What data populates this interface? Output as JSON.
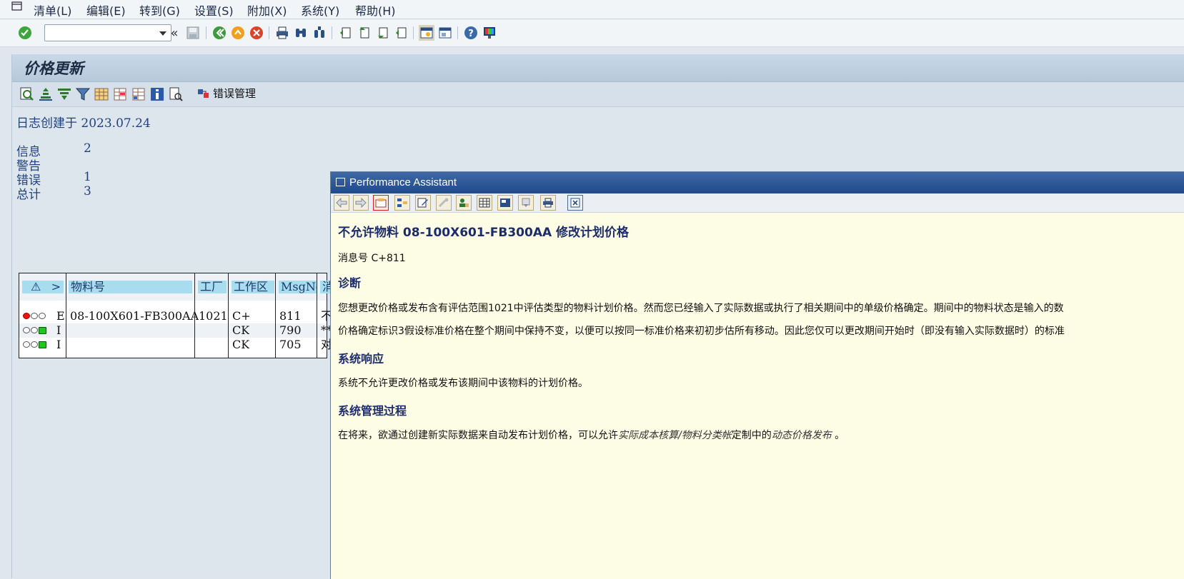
{
  "menu": {
    "items": [
      "清单(L)",
      "编辑(E)",
      "转到(G)",
      "设置(S)",
      "附加(X)",
      "系统(Y)",
      "帮助(H)"
    ]
  },
  "toolbar": {
    "command_value": "",
    "nav_back_label": "«"
  },
  "screen": {
    "title": "价格更新",
    "error_mgmt_label": "错误管理"
  },
  "log": {
    "created_text": "日志创建于 2023.07.24",
    "stats": [
      {
        "label": "信息",
        "value": "2"
      },
      {
        "label": "警告",
        "value": ""
      },
      {
        "label": "错误",
        "value": "1"
      },
      {
        "label": "总计",
        "value": "3"
      }
    ]
  },
  "grid": {
    "headers": [
      "⚠",
      "物料号",
      "工厂",
      "工作区",
      "MsgNo",
      "消"
    ],
    "rows": [
      {
        "light": "red",
        "type": "E",
        "material": "08-100X601-FB300AA",
        "plant": "1021",
        "area": "C+",
        "msgno": "811",
        "text": "不"
      },
      {
        "light": "green",
        "type": "I",
        "material": "",
        "plant": "",
        "area": "CK",
        "msgno": "790",
        "text": "**"
      },
      {
        "light": "green",
        "type": "I",
        "material": "",
        "plant": "",
        "area": "CK",
        "msgno": "705",
        "text": "对"
      }
    ]
  },
  "assistant": {
    "window_title": "Performance Assistant",
    "heading": "不允许物料 08-100X601-FB300AA  修改计划价格",
    "msg_no": "消息号 C+811",
    "h_diagnosis": "诊断",
    "diag_p1": "您想更改价格或发布含有评估范围1021中评估类型的物料计划价格。然而您已经输入了实际数据或执行了相关期间中的单级价格确定。期间中的物料状态是输入的数",
    "diag_p2": "价格确定标识3假设标准价格在整个期间中保持不变，以便可以按同一标准价格来初初步估所有移动。因此您仅可以更改期间开始时（即没有输入实际数据时）的标准",
    "h_response": "系统响应",
    "response_p": "系统不允许更改价格或发布该期间中该物料的计划价格。",
    "h_procedure": "系统管理过程",
    "proc_prefix": "在将来，欲通过创建新实际数据来自动发布计划价格，可以允许",
    "proc_link1": "实际成本核算/物料分类帐",
    "proc_mid": "定制中的",
    "proc_link2": "动态价格发布",
    "proc_suffix": " 。"
  }
}
